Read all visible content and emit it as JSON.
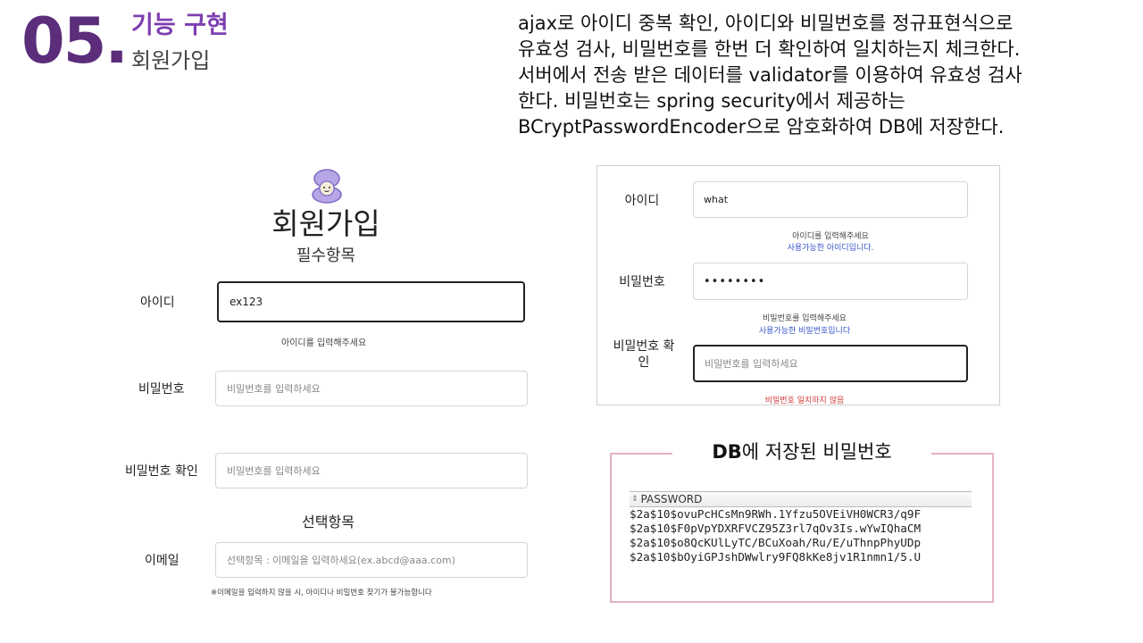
{
  "header": {
    "number": "05",
    "dot": ".",
    "section_title": "기능 구현",
    "section_subtitle": "회원가입"
  },
  "description_lines": [
    "ajax로 아이디 중복 확인, 아이디와 비밀번호를 정규표현식으로",
    "유효성 검사, 비밀번호를 한번 더 확인하여 일치하는지 체크한다.",
    "서버에서 전송 받은 데이터를 validator를 이용하여 유효성 검사",
    "한다. 비밀번호는 spring security에서 제공하는",
    "BCryptPasswordEncoder으로  암호화하여 DB에 저장한다."
  ],
  "signup": {
    "title": "회원가입",
    "required_heading": "필수항목",
    "id_label": "아이디",
    "id_value": "ex123",
    "id_helper": "아이디를 입력해주세요",
    "pw_label": "비밀번호",
    "pw_placeholder": "비밀번호를 입력하세요",
    "pw_confirm_label": "비밀번호 확인",
    "pw_confirm_placeholder": "비밀번호를 입력하세요",
    "optional_heading": "선택항목",
    "email_label": "이메일",
    "email_placeholder": "선택항목 : 이메일을 입력하세요(ex.abcd@aaa.com)",
    "email_note": "※이메일을 입력하지 않을 시, 아이디나 비밀번호 찾기가 불가능합니다"
  },
  "validation": {
    "id_label": "아이디",
    "id_value": "what",
    "id_helper": "아이디를 입력해주세요",
    "id_ok": "사용가능한 아이디입니다.",
    "pw_label": "비밀번호",
    "pw_value": "••••••••",
    "pw_helper": "비밀번호를 입력해주세요",
    "pw_ok": "사용가능한 비밀번호입니다",
    "pw_confirm_label_line1": "비밀번호 확",
    "pw_confirm_label_line2": "인",
    "pw_confirm_placeholder": "비밀번호를 입력하세요",
    "pw_mismatch": "비밀번호 일치하지 않음"
  },
  "db": {
    "title_bold": "DB",
    "title_rest": "에 저장된 비밀번호",
    "column_header": "PASSWORD",
    "rows": [
      "$2a$10$ovuPcHCsMn9RWh.1Yfzu5OVEiVH0WCR3/q9F",
      "$2a$10$F0pVpYDXRFVCZ95Z3rl7qOv3Is.wYwIQhaCM",
      "$2a$10$o8QcKUlLyTC/BCuXoah/Ru/E/uThnpPhyUDp",
      "$2a$10$bOyiGPJshDWwlry9FQ8kKe8jv1R1nmn1/5.U"
    ]
  },
  "colors": {
    "title_purple": "#5b2d7a",
    "section_purple": "#7d3fb0",
    "ok_blue": "#3553c9",
    "error_red": "#d43a3a",
    "db_border_pink": "#e3b2c0"
  }
}
